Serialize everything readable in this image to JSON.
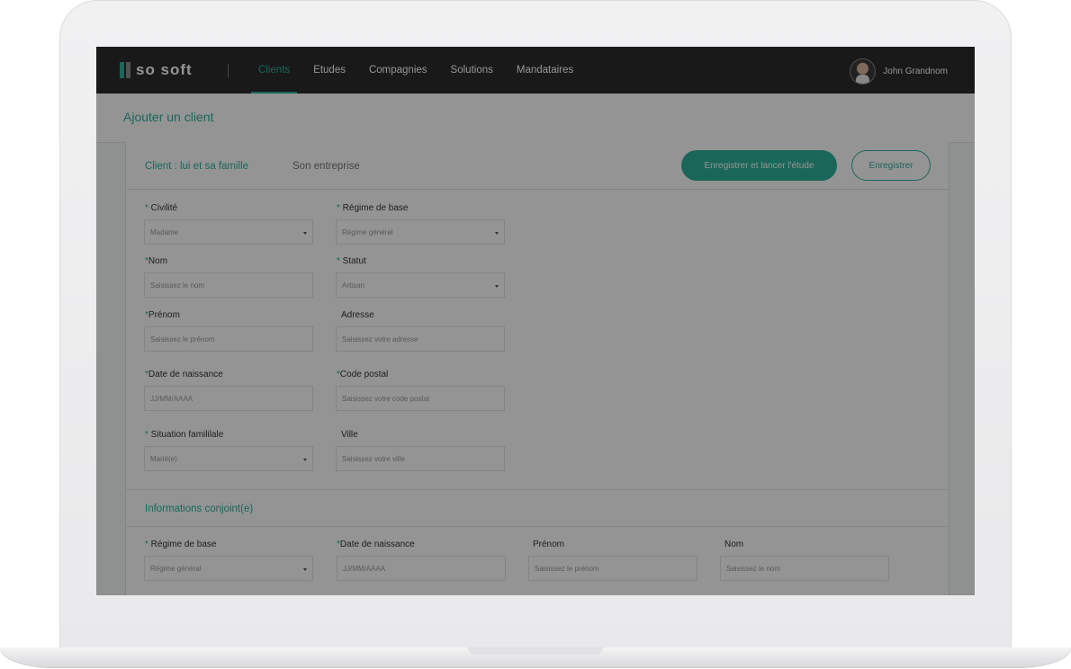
{
  "brand": {
    "name": "so soft"
  },
  "nav": {
    "items": [
      "Clients",
      "Etudes",
      "Compagnies",
      "Solutions",
      "Mandataires"
    ],
    "active": "Clients"
  },
  "user": {
    "name": "John Grandnom"
  },
  "page": {
    "title": "Ajouter un client"
  },
  "tabs": {
    "active": "Client : lui et sa famille",
    "inactive": "Son entreprise"
  },
  "actions": {
    "save_and_launch": "Enregistrer et lancer l'étude",
    "save": "Enregistrer"
  },
  "client_form": {
    "civilite": {
      "label": "Civilité",
      "value": "Madame"
    },
    "regime": {
      "label": "Régime de base",
      "value": "Régime général"
    },
    "nom": {
      "label": "Nom",
      "placeholder": "Saisissez le nom"
    },
    "statut": {
      "label": "Statut",
      "value": "Artisan"
    },
    "prenom": {
      "label": "Prénom",
      "placeholder": "Saisissez le prénom"
    },
    "adresse": {
      "label": "Adresse",
      "placeholder": "Saisissez votre adresse"
    },
    "date_naissance": {
      "label": "Date de naissance",
      "placeholder": "JJ/MM/AAAA"
    },
    "code_postal": {
      "label": "Code postal",
      "placeholder": "Saisissez votre code postal"
    },
    "situation": {
      "label": "Situation famililale",
      "value": "Marié(e)"
    },
    "ville": {
      "label": "Ville",
      "placeholder": "Saisissez votre ville"
    }
  },
  "conjoint": {
    "title": "Informations conjoint(e)",
    "regime": {
      "label": "Régime de base",
      "value": "Régime général"
    },
    "date_naissance": {
      "label": "Date de naissance",
      "placeholder": "JJ/MM/AAAA"
    },
    "prenom": {
      "label": "Prénom",
      "placeholder": "Saisissez le prénom"
    },
    "nom": {
      "label": "Nom",
      "placeholder": "Saisissez le nom"
    }
  },
  "colors": {
    "accent": "#2db09a",
    "topbar": "#2c2c2c"
  }
}
